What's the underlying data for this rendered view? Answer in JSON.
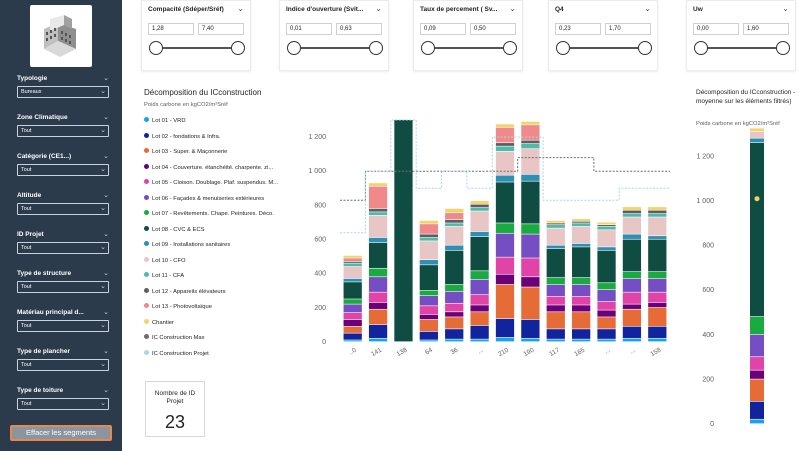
{
  "sidebar": {
    "logo_icon": "building-icon",
    "filters": [
      {
        "label": "Typologie",
        "value": "Bureaux"
      },
      {
        "label": "Zone Climatique",
        "value": "Tout"
      },
      {
        "label": "Catégorie (CE1...)",
        "value": "Tout"
      },
      {
        "label": "Altitude",
        "value": "Tout"
      },
      {
        "label": "ID Projet",
        "value": "Tout"
      },
      {
        "label": "Type de structure",
        "value": "Tout"
      },
      {
        "label": "Matériau principal d...",
        "value": "Tout"
      },
      {
        "label": "Type de plancher",
        "value": "Tout"
      },
      {
        "label": "Type de toiture",
        "value": "Tout"
      }
    ],
    "clear_button": "Effacer les segments"
  },
  "slicers": [
    {
      "title": "Compacité (Sdéper/Sréf)",
      "min": "1,28",
      "max": "7,40"
    },
    {
      "title": "Indice d'ouverture (Svit...",
      "min": "0,01",
      "max": "0,63"
    },
    {
      "title": "Taux de percement ( Sv...",
      "min": "0,09",
      "max": "0,50"
    },
    {
      "title": "Q4",
      "min": "0,23",
      "max": "1,70"
    },
    {
      "title": "Uw",
      "min": "0,00",
      "max": "1,60"
    }
  ],
  "main_chart": {
    "title": "Décomposition du ICconstruction",
    "subtitle": "Poids carbone en kgCO2/m²Sréf"
  },
  "side_chart": {
    "title": "Décomposition du ICconstruction - moyenne sur les éléments filtrés)",
    "subtitle": "Poids carbone en kgCO2/m²Sréf"
  },
  "legend": [
    {
      "label": "Lot 01 - VRD",
      "color": "#1aa1e6"
    },
    {
      "label": "Lot 02 - fondations & Infra.",
      "color": "#12239e"
    },
    {
      "label": "Lot 03 - Super. & Maçonnerie",
      "color": "#e66c37"
    },
    {
      "label": "Lot 04 - Couverture. étanchéité. charpente. zi...",
      "color": "#6b007b"
    },
    {
      "label": "Lot 05 - Cloison. Doublage. Plaf. suspendus. M...",
      "color": "#e044a7"
    },
    {
      "label": "Lot 06 - Façades & menuiseries extérieures",
      "color": "#744ec2"
    },
    {
      "label": "Lot 07 - Revêtements. Chape. Peintures. Déco.",
      "color": "#1aab40"
    },
    {
      "label": "Lot 08 - CVC & ECS",
      "color": "#0f4d43"
    },
    {
      "label": "Lot 09 - Installations sanitaires",
      "color": "#2d8fb3"
    },
    {
      "label": "Lot 10 - CFO",
      "color": "#e8c6c6"
    },
    {
      "label": "Lot 11 - CFA",
      "color": "#52b9a9"
    },
    {
      "label": "Lot 12 - Appareils élévateurs",
      "color": "#5a5f63"
    },
    {
      "label": "Lot 13 - Photovoltaïque",
      "color": "#f08a8a"
    },
    {
      "label": "Chantier",
      "color": "#f5d36a"
    },
    {
      "label": "IC Construction Max",
      "color": "#6a6e72"
    },
    {
      "label": "IC Construction Projet",
      "color": "#a9d4ee"
    }
  ],
  "kpi": {
    "label": "Nombre de ID Projet",
    "value": "23"
  },
  "chart_data": [
    {
      "type": "bar",
      "title": "Décomposition du ICconstruction",
      "ylabel": "Poids carbone en kgCO2/m²Sréf",
      "ylim": [
        0,
        1300
      ],
      "yticks": [
        0,
        200,
        400,
        600,
        800,
        1000,
        1200
      ],
      "ytick_labels": [
        "0",
        "200",
        "400",
        "600",
        "800",
        "1 000",
        "1 200"
      ],
      "categories": [
        "..0",
        "141",
        "138",
        "64",
        "36",
        "...",
        "210",
        "190",
        "117",
        "165",
        "...",
        "...",
        "158"
      ],
      "colors": [
        "#1aa1e6",
        "#12239e",
        "#e66c37",
        "#6b007b",
        "#e044a7",
        "#744ec2",
        "#1aab40",
        "#0f4d43",
        "#2d8fb3",
        "#e8c6c6",
        "#52b9a9",
        "#5a5f63",
        "#f08a8a",
        "#f5d36a"
      ],
      "series": [
        {
          "name": "Lot 01 - VRD",
          "values": [
            10,
            20,
            0,
            10,
            15,
            15,
            25,
            20,
            15,
            15,
            15,
            20,
            20
          ]
        },
        {
          "name": "Lot 02 - fondations & Infra.",
          "values": [
            40,
            80,
            0,
            50,
            60,
            80,
            110,
            110,
            60,
            60,
            60,
            70,
            70
          ]
        },
        {
          "name": "Lot 03 - Super. & Maçonnerie",
          "values": [
            40,
            90,
            0,
            70,
            70,
            80,
            200,
            190,
            100,
            100,
            70,
            100,
            110
          ]
        },
        {
          "name": "Lot 04 - Couverture. étanchéité. charpente. zi...",
          "values": [
            40,
            40,
            0,
            30,
            30,
            40,
            60,
            60,
            40,
            40,
            40,
            30,
            30
          ]
        },
        {
          "name": "Lot 05 - Cloison. Doublage. Plaf. suspendus. M...",
          "values": [
            40,
            60,
            0,
            50,
            50,
            60,
            100,
            110,
            50,
            50,
            50,
            70,
            60
          ]
        },
        {
          "name": "Lot 06 - Façades & menuiseries extérieures",
          "values": [
            50,
            90,
            0,
            60,
            70,
            90,
            140,
            140,
            70,
            70,
            70,
            80,
            80
          ]
        },
        {
          "name": "Lot 07 - Revêtements. Chape. Peintures. Déco.",
          "values": [
            30,
            50,
            0,
            30,
            40,
            50,
            60,
            60,
            40,
            40,
            40,
            40,
            40
          ]
        },
        {
          "name": "Lot 08 - CVC & ECS",
          "values": [
            100,
            150,
            1300,
            150,
            200,
            200,
            240,
            250,
            170,
            180,
            190,
            190,
            190
          ]
        },
        {
          "name": "Lot 09 - Installations sanitaires",
          "values": [
            20,
            30,
            0,
            30,
            30,
            30,
            40,
            40,
            20,
            20,
            20,
            30,
            20
          ]
        },
        {
          "name": "Lot 10 - CFO",
          "values": [
            70,
            130,
            0,
            110,
            110,
            120,
            140,
            150,
            100,
            100,
            100,
            100,
            110
          ]
        },
        {
          "name": "Lot 11 - CFA",
          "values": [
            20,
            20,
            0,
            20,
            20,
            20,
            30,
            30,
            20,
            20,
            20,
            20,
            20
          ]
        },
        {
          "name": "Lot 12 - Appareils élévateurs",
          "values": [
            10,
            20,
            0,
            20,
            20,
            20,
            20,
            20,
            10,
            10,
            10,
            20,
            20
          ]
        },
        {
          "name": "Lot 13 - Photovoltaïque",
          "values": [
            20,
            130,
            0,
            60,
            40,
            0,
            90,
            90,
            0,
            0,
            0,
            0,
            0
          ]
        },
        {
          "name": "Chantier",
          "values": [
            15,
            20,
            0,
            20,
            25,
            20,
            20,
            20,
            15,
            15,
            15,
            20,
            20
          ]
        }
      ],
      "ic_construction_max": [
        830,
        1000,
        1000,
        1000,
        1000,
        1000,
        1000,
        1080,
        1080,
        1080,
        1000,
        1000,
        1000
      ],
      "ic_construction_projet": [
        640,
        1000,
        1300,
        900,
        1000,
        900,
        1200,
        1200,
        830,
        830,
        830,
        900,
        900
      ]
    },
    {
      "type": "bar",
      "title": "Décomposition du ICconstruction - moyenne sur les éléments filtrés)",
      "ylabel": "Poids carbone en kgCO2/m²Sréf",
      "ylim": [
        0,
        1300
      ],
      "yticks": [
        0,
        200,
        400,
        600,
        800,
        1000,
        1200
      ],
      "ytick_labels": [
        "0",
        "200",
        "400",
        "600",
        "800",
        "1 000",
        "1 200"
      ],
      "categories": [
        ""
      ],
      "series_values": [
        20,
        80,
        100,
        40,
        60,
        100,
        80,
        780,
        20,
        30,
        0,
        0,
        0,
        15
      ],
      "marker_value": 1010
    }
  ]
}
